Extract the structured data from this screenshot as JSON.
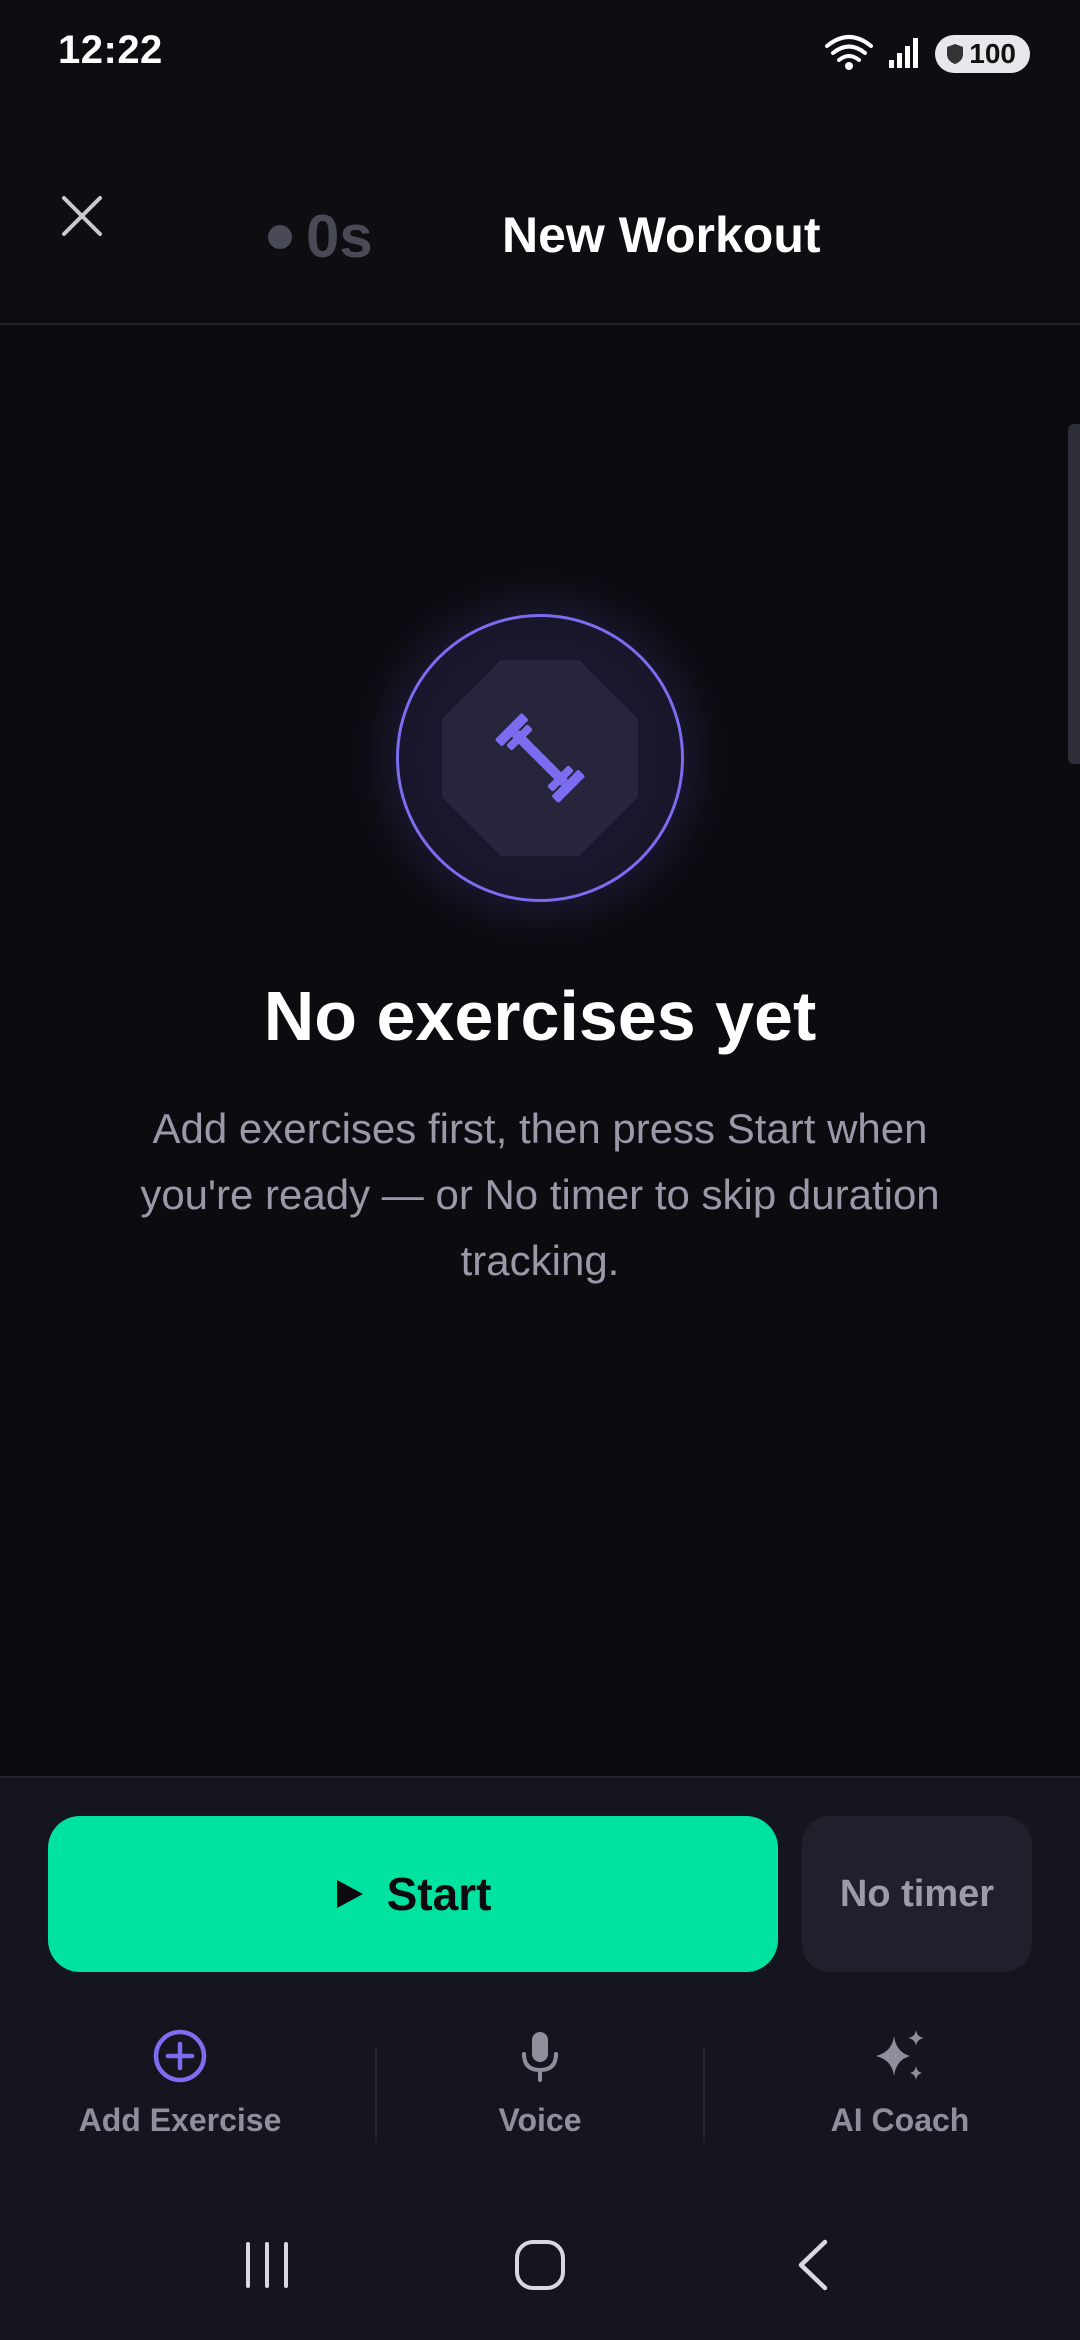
{
  "status_bar": {
    "time": "12:22",
    "battery": "100",
    "icons": [
      "wifi-icon",
      "signal-icon",
      "battery-icon"
    ]
  },
  "header": {
    "timer_value": "0s",
    "title": "New Workout",
    "close_icon": "close-icon"
  },
  "empty_state": {
    "icon": "dumbbell-icon",
    "title": "No exercises yet",
    "description": "Add exercises first, then press Start when you're ready — or No timer to skip duration tracking."
  },
  "controls": {
    "start_label": "Start",
    "start_icon": "play-icon",
    "no_timer_label": "No timer"
  },
  "actions": [
    {
      "label": "Add Exercise",
      "icon": "add-circle-icon"
    },
    {
      "label": "Voice",
      "icon": "microphone-icon"
    },
    {
      "label": "AI Coach",
      "icon": "sparkles-icon"
    }
  ],
  "colors": {
    "background": "#0b0b10",
    "accent_green": "#00e3a0",
    "accent_purple": "#7b6cf0",
    "muted_text": "#9a99a8",
    "panel": "#15151f"
  }
}
